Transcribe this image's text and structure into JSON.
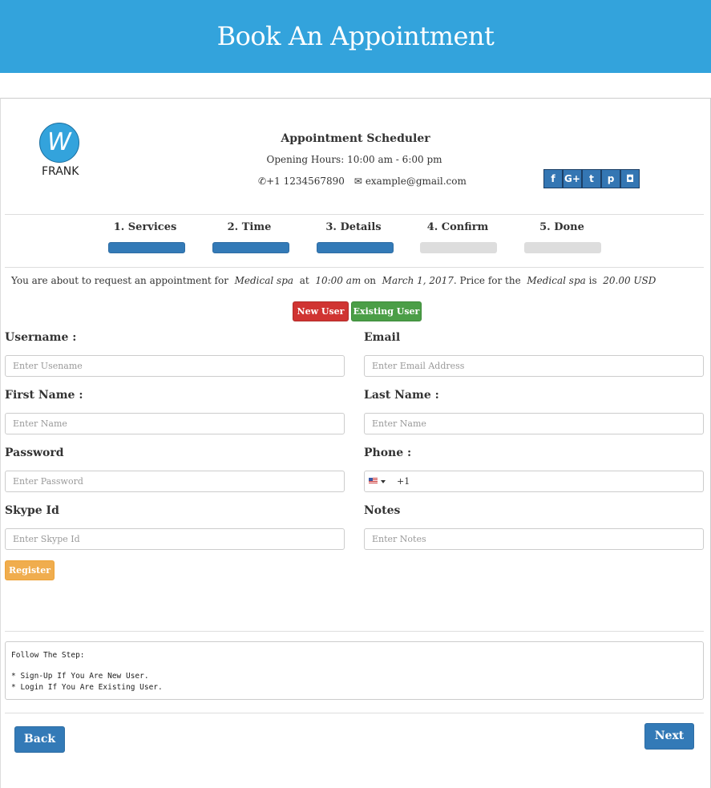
{
  "header": {
    "title": "Book An Appointment"
  },
  "logo": {
    "letter": "W",
    "text": "FRANK"
  },
  "business": {
    "title": "Appointment Scheduler",
    "hours": "Opening Hours: 10:00 am - 6:00 pm",
    "phone": "+1 1234567890",
    "email": "example@gmail.com"
  },
  "social": [
    {
      "name": "facebook",
      "glyph": "f"
    },
    {
      "name": "google-plus",
      "glyph": "G+"
    },
    {
      "name": "twitter",
      "glyph": "t"
    },
    {
      "name": "pinterest",
      "glyph": "p"
    },
    {
      "name": "instagram",
      "glyph": "◘"
    }
  ],
  "steps": [
    {
      "label": "1. Services",
      "complete": true
    },
    {
      "label": "2. Time",
      "complete": true
    },
    {
      "label": "3. Details",
      "complete": true
    },
    {
      "label": "4. Confirm",
      "complete": false
    },
    {
      "label": "5. Done",
      "complete": false
    }
  ],
  "summary": {
    "prefix": "You are about to request an appointment for",
    "service": "Medical spa",
    "at": "at",
    "time": "10:00 am",
    "on": "on",
    "date": "March 1, 2017",
    "price_text": ". Price for the",
    "service2": "Medical spa",
    "is": "is",
    "price": "20.00 USD"
  },
  "user_toggle": {
    "new_user": "New User",
    "existing_user": "Existing User"
  },
  "form": {
    "username": {
      "label": "Username :",
      "placeholder": "Enter Usename"
    },
    "email": {
      "label": "Email",
      "placeholder": "Enter Email Address"
    },
    "first_name": {
      "label": "First Name :",
      "placeholder": "Enter Name"
    },
    "last_name": {
      "label": "Last Name :",
      "placeholder": "Enter Name"
    },
    "password": {
      "label": "Password",
      "placeholder": "Enter Password"
    },
    "phone": {
      "label": "Phone :",
      "dial_code": "+1",
      "country": "us-flag-icon"
    },
    "skype": {
      "label": "Skype Id",
      "placeholder": "Enter Skype Id"
    },
    "notes": {
      "label": "Notes",
      "placeholder": "Enter Notes"
    },
    "register": "Register"
  },
  "instructions": {
    "title": "Follow The Step:",
    "line1": "* Sign-Up If You Are New User.",
    "line2": "* Login If You Are Existing User."
  },
  "nav": {
    "back": "Back",
    "next": "Next"
  },
  "colors": {
    "header": "#33a3dc",
    "primary": "#337ab7",
    "danger": "#d03432",
    "success": "#4b9e47",
    "warning": "#f0ad4e"
  }
}
